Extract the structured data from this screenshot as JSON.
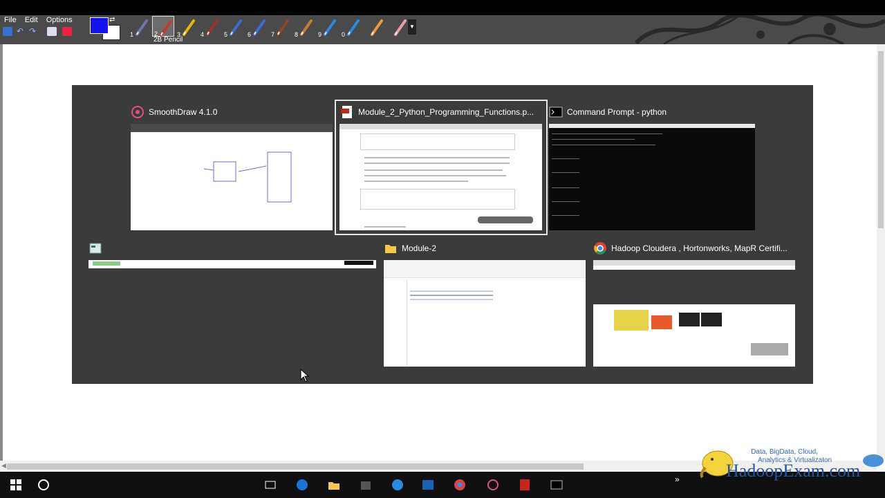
{
  "app": {
    "menu": [
      "File",
      "Edit",
      "Options"
    ],
    "current_tool_name": "2B Pencil",
    "colors": {
      "foreground": "#1414f0",
      "background": "#ffffff"
    },
    "tools": [
      {
        "num": "1",
        "icon": "pen-icon"
      },
      {
        "num": "2",
        "icon": "pencil-icon"
      },
      {
        "num": "3",
        "icon": "highlighter-icon"
      },
      {
        "num": "4",
        "icon": "marker-icon"
      },
      {
        "num": "5",
        "icon": "brush-icon"
      },
      {
        "num": "6",
        "icon": "brush-icon"
      },
      {
        "num": "7",
        "icon": "brush-icon"
      },
      {
        "num": "8",
        "icon": "brush-icon"
      },
      {
        "num": "9",
        "icon": "spray-icon"
      },
      {
        "num": "0",
        "icon": "water-drop-icon"
      },
      {
        "num": "",
        "icon": "hand-icon"
      },
      {
        "num": "",
        "icon": "eraser-icon"
      }
    ]
  },
  "task_switcher": {
    "windows": [
      {
        "id": "smoothdraw",
        "title": "SmoothDraw 4.1.0",
        "icon": "smoothdraw-icon",
        "selected": false
      },
      {
        "id": "pdf",
        "title": "Module_2_Python_Programming_Functions.p...",
        "icon": "pdf-icon",
        "selected": true
      },
      {
        "id": "cmd",
        "title": "Command Prompt - python",
        "icon": "command-prompt-icon",
        "selected": false
      },
      {
        "id": "app4",
        "title": "",
        "icon": "app-window-icon",
        "selected": false
      },
      {
        "id": "explorer",
        "title": "Module-2",
        "icon": "folder-icon",
        "selected": false
      },
      {
        "id": "chrome",
        "title": "Hadoop Cloudera , Hortonworks, MapR Certifi...",
        "icon": "chrome-icon",
        "selected": false
      }
    ]
  },
  "logo": {
    "tagline_1": "Data, BigData, Cloud,",
    "tagline_2": "Analytics & Virtualizaton",
    "brand": "HadoopExam.com"
  }
}
